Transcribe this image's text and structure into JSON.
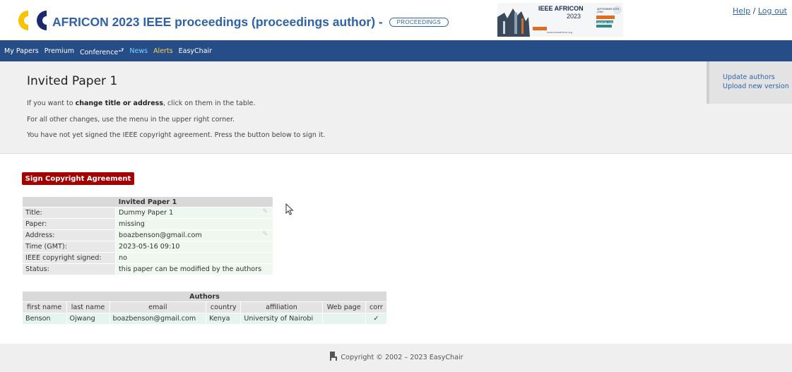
{
  "header": {
    "title": "AFRICON 2023 IEEE proceedings (proceedings author) -",
    "badge": "PROCEEDINGS",
    "banner": {
      "name": "IEEE AFRICON",
      "year": "2023",
      "dates": "SEPTEMBER 20TH - 22ND",
      "location": "NAIROBI, KENYA"
    },
    "help_label": "Help",
    "separator": "/",
    "logout_label": "Log out"
  },
  "nav": {
    "items": [
      "My Papers",
      "Premium",
      "Conference",
      "News",
      "Alerts",
      "EasyChair"
    ]
  },
  "info": {
    "heading": "Invited Paper 1",
    "line1_prefix": "If you want to ",
    "line1_bold": "change title or address",
    "line1_suffix": ", click on them in the table.",
    "line2": "For all other changes, use the menu in the upper right corner.",
    "line3": "You have not yet signed the IEEE copyright agreement. Press the button below to sign it."
  },
  "sidemenu": {
    "items": [
      "Update authors",
      "Upload new version"
    ]
  },
  "sign_button": "Sign Copyright Agreement",
  "paper_table": {
    "caption": "Invited Paper 1",
    "rows": [
      {
        "key": "Title:",
        "value": "Dummy Paper 1"
      },
      {
        "key": "Paper:",
        "value": "missing"
      },
      {
        "key": "Address:",
        "value": "boazbenson@gmail.com"
      },
      {
        "key": "Time (GMT):",
        "value": "2023-05-16 09:10"
      },
      {
        "key": "IEEE copyright signed:",
        "value": "no"
      },
      {
        "key": "Status:",
        "value": "this paper can be modified by the authors"
      }
    ]
  },
  "authors_table": {
    "caption": "Authors",
    "columns": [
      "first name",
      "last name",
      "email",
      "country",
      "affiliation",
      "Web page",
      "corr"
    ],
    "rows": [
      [
        "Benson",
        "Ojwang",
        "boazbenson@gmail.com",
        "Kenya",
        "University of Nairobi",
        "",
        "✓"
      ]
    ]
  },
  "footer": {
    "text": "Copyright © 2002 – 2023 EasyChair"
  },
  "colors": {
    "brand_blue": "#2e63a9",
    "nav_bg": "#264d87",
    "button_red": "#a40000",
    "logo_yellow": "#f5c400"
  }
}
